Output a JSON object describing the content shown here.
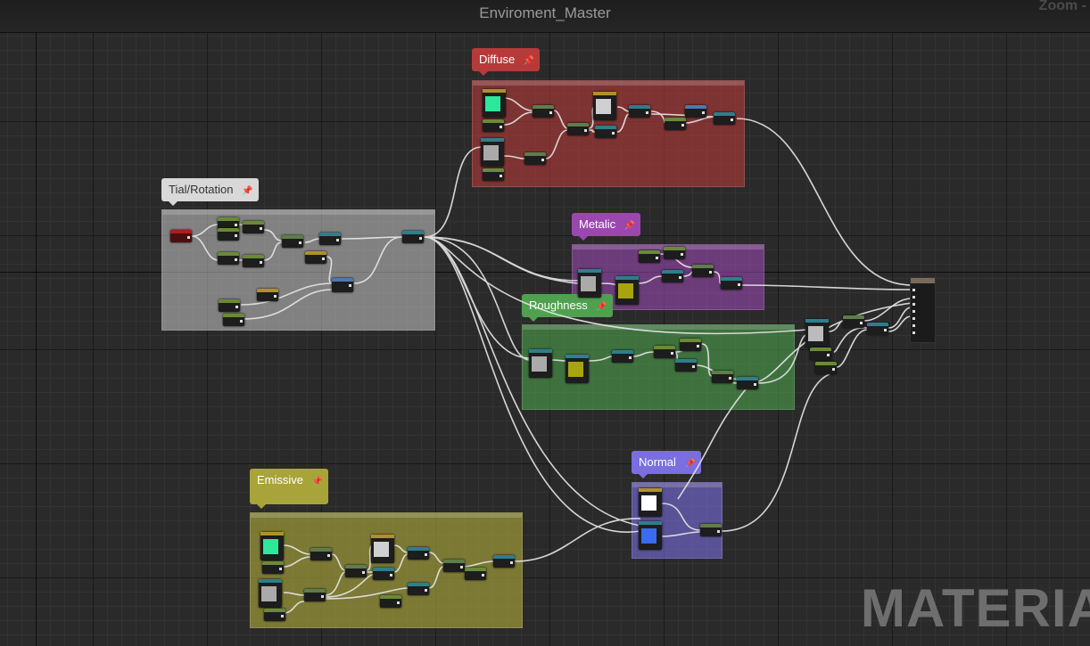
{
  "window": {
    "title": "Enviroment_Master",
    "zoom_label": "Zoom -"
  },
  "comments": {
    "diffuse": {
      "label": "Diffuse",
      "color": "#b73a3a"
    },
    "tial_rotation": {
      "label": "Tial/Rotation",
      "color": "#d8d8d8"
    },
    "metalic": {
      "label": "Metalic",
      "color": "#9a48b0"
    },
    "roughness": {
      "label": "Roughness",
      "color": "#4fa14f"
    },
    "normal": {
      "label": "Normal",
      "color": "#7a6ee0"
    },
    "emissive": {
      "label": "Emissive",
      "color": "#a8a43a"
    }
  },
  "watermark": {
    "text": "MATERIAL"
  },
  "icons": {
    "pin": "pin-icon",
    "comment_toggle": "comment-toggle-icon"
  }
}
